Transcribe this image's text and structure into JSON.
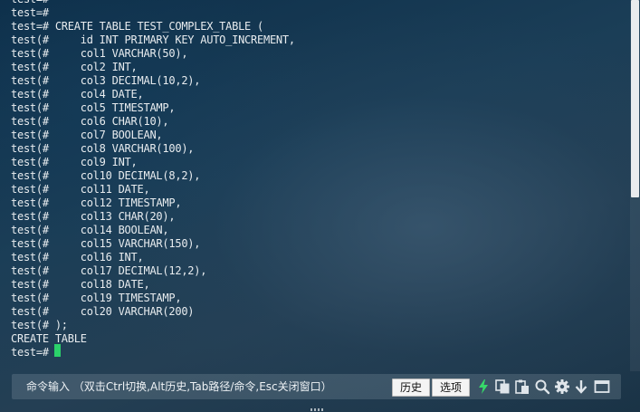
{
  "terminal": {
    "lines": [
      "test=#",
      "test=#",
      "test=# CREATE TABLE TEST_COMPLEX_TABLE (",
      "test(#     id INT PRIMARY KEY AUTO_INCREMENT,",
      "test(#     col1 VARCHAR(50),",
      "test(#     col2 INT,",
      "test(#     col3 DECIMAL(10,2),",
      "test(#     col4 DATE,",
      "test(#     col5 TIMESTAMP,",
      "test(#     col6 CHAR(10),",
      "test(#     col7 BOOLEAN,",
      "test(#     col8 VARCHAR(100),",
      "test(#     col9 INT,",
      "test(#     col10 DECIMAL(8,2),",
      "test(#     col11 DATE,",
      "test(#     col12 TIMESTAMP,",
      "test(#     col13 CHAR(20),",
      "test(#     col14 BOOLEAN,",
      "test(#     col15 VARCHAR(150),",
      "test(#     col16 INT,",
      "test(#     col17 DECIMAL(12,2),",
      "test(#     col18 DATE,",
      "test(#     col19 TIMESTAMP,",
      "test(#     col20 VARCHAR(200)",
      "test(# );",
      "CREATE TABLE",
      "test=#"
    ],
    "cursor_color": "#2bd26a"
  },
  "command_bar": {
    "hint": "命令输入 （双击Ctrl切换,Alt历史,Tab路径/命令,Esc关闭窗口）",
    "history_button": "历史",
    "options_button": "选项",
    "icons": [
      "lightning-icon",
      "copy-icon",
      "paste-icon",
      "search-icon",
      "gear-icon",
      "download-icon",
      "window-icon"
    ],
    "accent_color": "#37d86a"
  }
}
